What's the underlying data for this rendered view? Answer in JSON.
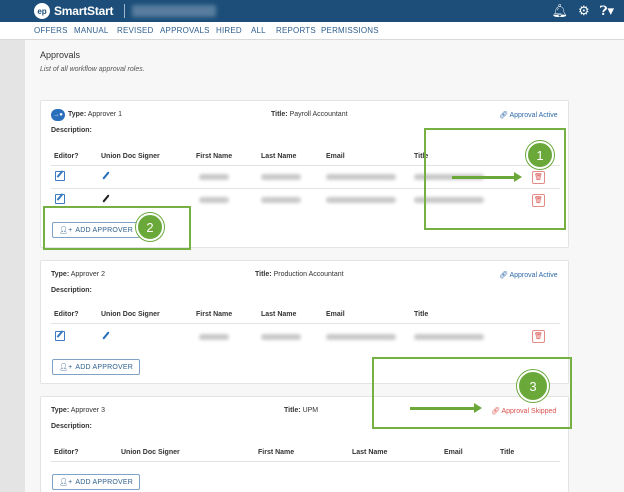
{
  "app": {
    "name": "SmartStart",
    "logo_mark": "ep"
  },
  "top_icons": {
    "bell": "bell-icon",
    "gear": "gear-icon",
    "help": "help-icon"
  },
  "nav": [
    "OFFERS",
    "MANUAL",
    "REVISED",
    "APPROVALS",
    "HIRED",
    "ALL",
    "REPORTS",
    "PERMISSIONS"
  ],
  "page": {
    "title": "Approvals",
    "subtitle": "List of all workflow approval roles."
  },
  "labels": {
    "type": "Type:",
    "title": "Title:",
    "description": "Description:",
    "add_approver": "ADD APPROVER",
    "approval_active": "Approval Active",
    "approval_skipped": "Approval Skipped"
  },
  "columns": [
    "Editor?",
    "Union Doc Signer",
    "First Name",
    "Last Name",
    "Email",
    "Title"
  ],
  "approvers": [
    {
      "type": "Approver 1",
      "title": "Payroll Accountant",
      "status": "Approval Active"
    },
    {
      "type": "Approver 2",
      "title": "Production Accountant",
      "status": "Approval Active"
    },
    {
      "type": "Approver 3",
      "title": "UPM",
      "status": "Approval Skipped"
    }
  ],
  "callouts": [
    "1",
    "2",
    "3"
  ],
  "colors": {
    "header": "#1c4e79",
    "link": "#2f5f8e",
    "active": "#2f6aa8",
    "skipped": "#d9534f",
    "callout": "#6aa83a"
  }
}
